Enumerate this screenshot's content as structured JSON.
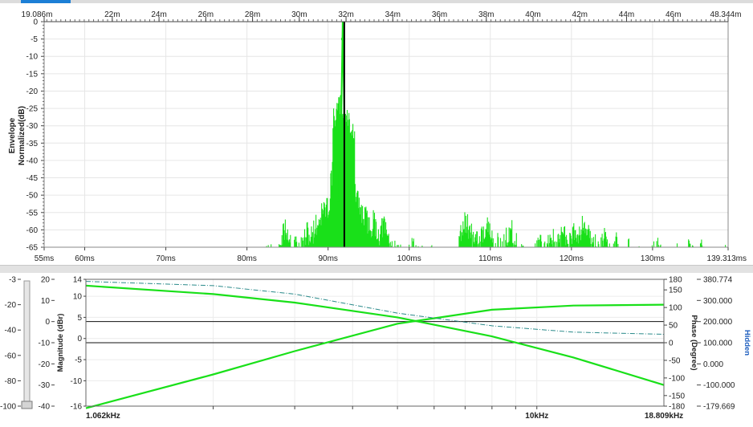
{
  "colors": {
    "trace": "#19e019",
    "marker": "#000000",
    "dash_trace": "#2a8a8a",
    "hidden_label": "#1f5fbf"
  },
  "chart_data": [
    {
      "type": "line",
      "name": "envelope-time-domain",
      "ylabel": "Envelope Normalized(dB)",
      "ylim": [
        -65,
        0
      ],
      "y_ticks": [
        "0",
        "-5",
        "-10",
        "-15",
        "-20",
        "-25",
        "-30",
        "-35",
        "-40",
        "-45",
        "-50",
        "-55",
        "-60",
        "-65"
      ],
      "x_range_ms": [
        55,
        139.313
      ],
      "x_ticks": [
        "55ms",
        "60ms",
        "70ms",
        "80ms",
        "90ms",
        "100ms",
        "110ms",
        "120ms",
        "130ms",
        "139.313ms"
      ],
      "distance_axis_ticks": [
        "19.086m",
        "22m",
        "24m",
        "26m",
        "28m",
        "30m",
        "32m",
        "34m",
        "36m",
        "38m",
        "40m",
        "42m",
        "44m",
        "46m",
        "48.344m"
      ],
      "peak_ms": 91.8,
      "peak_db": 0,
      "marker_ms": 92.0,
      "grid": true,
      "envelope_clusters": [
        {
          "t": 82.8,
          "db": -61
        },
        {
          "t": 84.8,
          "db": -56
        },
        {
          "t": 86.0,
          "db": -60
        },
        {
          "t": 87.5,
          "db": -57
        },
        {
          "t": 88.5,
          "db": -55
        },
        {
          "t": 89.5,
          "db": -50
        },
        {
          "t": 90.6,
          "db": -46
        },
        {
          "t": 91.2,
          "db": -36
        },
        {
          "t": 91.5,
          "db": -20
        },
        {
          "t": 92.4,
          "db": -24
        },
        {
          "t": 92.8,
          "db": -43
        },
        {
          "t": 93.6,
          "db": -48
        },
        {
          "t": 94.5,
          "db": -52
        },
        {
          "t": 95.6,
          "db": -54
        },
        {
          "t": 96.8,
          "db": -55
        },
        {
          "t": 97.8,
          "db": -60
        },
        {
          "t": 99.0,
          "db": -62
        },
        {
          "t": 100.5,
          "db": -61
        },
        {
          "t": 101.5,
          "db": -63
        },
        {
          "t": 103.0,
          "db": -63
        },
        {
          "t": 107.0,
          "db": -54
        },
        {
          "t": 108.0,
          "db": -58
        },
        {
          "t": 109.5,
          "db": -55
        },
        {
          "t": 111.0,
          "db": -60
        },
        {
          "t": 112.5,
          "db": -56
        },
        {
          "t": 114.0,
          "db": -63
        },
        {
          "t": 116.0,
          "db": -60
        },
        {
          "t": 117.5,
          "db": -58
        },
        {
          "t": 119.0,
          "db": -57
        },
        {
          "t": 120.5,
          "db": -56
        },
        {
          "t": 121.5,
          "db": -54
        },
        {
          "t": 122.8,
          "db": -60
        },
        {
          "t": 124.0,
          "db": -58
        },
        {
          "t": 125.5,
          "db": -60
        },
        {
          "t": 127.0,
          "db": -62
        },
        {
          "t": 128.5,
          "db": -63
        },
        {
          "t": 130.5,
          "db": -61
        },
        {
          "t": 133.0,
          "db": -63
        },
        {
          "t": 134.5,
          "db": -61
        },
        {
          "t": 136.0,
          "db": -62
        },
        {
          "t": 137.5,
          "db": -63
        },
        {
          "t": 139.0,
          "db": -64
        }
      ]
    },
    {
      "type": "line",
      "name": "frequency-response",
      "x_scale": "log",
      "x_range_hz": [
        1062,
        18809
      ],
      "x_ticks": [
        "1.062kHz",
        "10kHz",
        "18.809kHz"
      ],
      "magnitude_ylabel": "Magnitude (dBr)",
      "magnitude_ylim": [
        -16,
        14
      ],
      "magnitude_ticks": [
        "14",
        "10",
        "5",
        "0",
        "-5",
        "-10",
        "-16"
      ],
      "phase_ylabel": "Phase (Degree)",
      "phase_ylim": [
        -180,
        180
      ],
      "phase_ticks": [
        "180",
        "150",
        "100",
        "50",
        "0",
        "-50",
        "-100",
        "-150",
        "-180"
      ],
      "outer_left_ticks_1": [
        "20",
        "10",
        "0",
        "-10",
        "-20",
        "-30",
        "-40"
      ],
      "outer_left_ticks_2": [
        "-3",
        "-20",
        "-40",
        "-60",
        "-80",
        "-100"
      ],
      "hidden_label": "Hidden",
      "hidden_ticks": [
        "380.774",
        "300.000",
        "200.000",
        "100.000",
        "0.000",
        "-100.000",
        "-179.669"
      ],
      "reference_lines_db": [
        4,
        -1
      ],
      "series": [
        {
          "style": "solid",
          "x_hz": [
            1062,
            2000,
            3000,
            5000,
            8000,
            12000,
            18809
          ],
          "y_db": [
            12.5,
            10.5,
            8.5,
            5.0,
            0.5,
            -4.5,
            -11.0
          ]
        },
        {
          "style": "solid",
          "x_hz": [
            1062,
            2000,
            3000,
            5000,
            8000,
            12000,
            18809
          ],
          "y_db": [
            -16.5,
            -8.5,
            -3.0,
            3.5,
            6.8,
            7.8,
            8.0
          ]
        },
        {
          "style": "dash-dot",
          "x_hz": [
            1062,
            2000,
            3000,
            5000,
            8000,
            12000,
            18809
          ],
          "y_db": [
            13.5,
            12.5,
            10.5,
            6.0,
            3.0,
            1.5,
            1.0
          ]
        }
      ]
    }
  ]
}
